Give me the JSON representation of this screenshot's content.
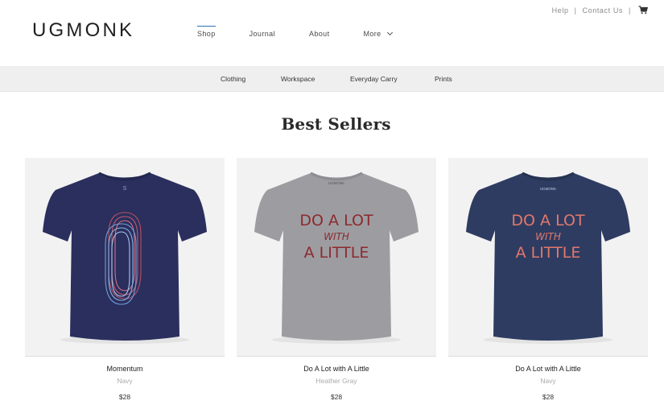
{
  "header": {
    "logo": "UGMONK",
    "nav": [
      {
        "label": "Shop",
        "active": true
      },
      {
        "label": "Journal"
      },
      {
        "label": "About"
      },
      {
        "label": "More"
      }
    ],
    "util": {
      "help": "Help",
      "separator": "|",
      "contact": "Contact Us",
      "cart_icon": "cart-icon"
    }
  },
  "subnav": [
    "Clothing",
    "Workspace",
    "Everyday Carry",
    "Prints"
  ],
  "section_title": "Best Sellers",
  "products": [
    {
      "name": "Momentum",
      "color": "Navy",
      "price": "$28",
      "shirt_color": "#2b2f5e",
      "neck_text": "S"
    },
    {
      "name": "Do A Lot with A Little",
      "color": "Heather Gray",
      "price": "$28",
      "shirt_color": "#9d9da1",
      "neck_text": "UGMONK",
      "print": [
        "DO A LOT",
        "WITH",
        "A LITTLE"
      ],
      "print_color": "#8c2a2f"
    },
    {
      "name": "Do A Lot with A Little",
      "color": "Navy",
      "price": "$28",
      "shirt_color": "#2e3c62",
      "neck_text": "UGMONK",
      "print": [
        "DO A LOT",
        "WITH",
        "A LITTLE"
      ],
      "print_color": "#e2786b"
    }
  ],
  "colors": {
    "accent": "#2b6fb3",
    "subnav_bg": "#efefef",
    "image_bg": "#f2f2f2"
  }
}
